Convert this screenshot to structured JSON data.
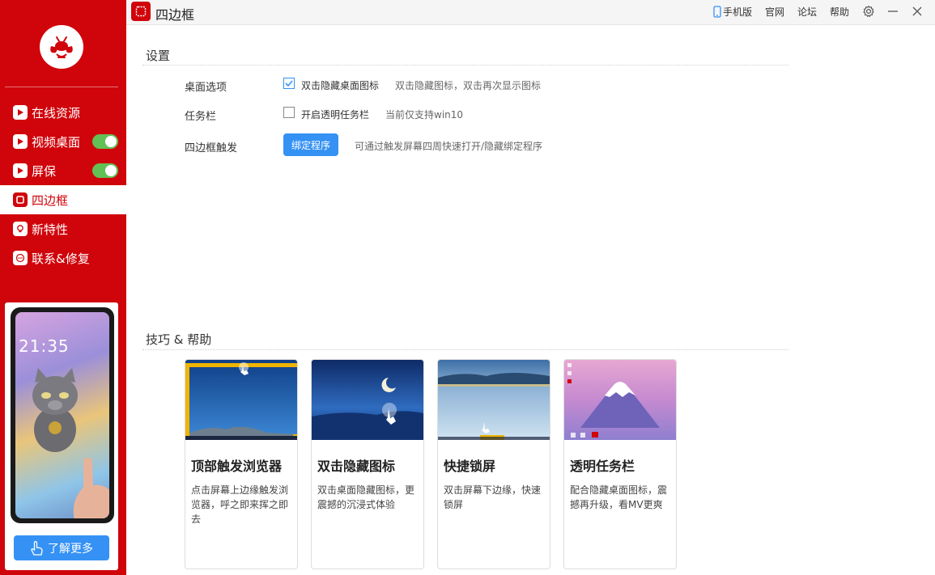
{
  "window": {
    "title": "四边框",
    "links": {
      "mobile": "手机版",
      "official": "官网",
      "forum": "论坛",
      "help": "帮助"
    }
  },
  "sidebar": {
    "items": [
      {
        "label": "在线资源",
        "icon": "play-icon",
        "toggle": null
      },
      {
        "label": "视频桌面",
        "icon": "play-icon",
        "toggle": true
      },
      {
        "label": "屏保",
        "icon": "play-icon",
        "toggle": true
      },
      {
        "label": "四边框",
        "icon": "frame-icon",
        "toggle": null,
        "active": true
      },
      {
        "label": "新特性",
        "icon": "bulb-icon",
        "toggle": null
      },
      {
        "label": "联系&修复",
        "icon": "chat-icon",
        "toggle": null
      }
    ],
    "promo": {
      "phone_time": "21:35",
      "button_label": "了解更多"
    }
  },
  "settings": {
    "title": "设置",
    "desktop": {
      "label": "桌面选项",
      "option": "双击隐藏桌面图标",
      "checked": true,
      "hint": "双击隐藏图标，双击再次显示图标"
    },
    "taskbar": {
      "label": "任务栏",
      "option": "开启透明任务栏",
      "checked": false,
      "hint": "当前仅支持win10"
    },
    "trigger": {
      "label": "四边框触发",
      "button": "绑定程序",
      "hint": "可通过触发屏幕四周快速打开/隐藏绑定程序"
    }
  },
  "help": {
    "title": "技巧 & 帮助",
    "cards": [
      {
        "title": "顶部触发浏览器",
        "desc": "点击屏幕上边缘触发浏览器，呼之即来挥之即去"
      },
      {
        "title": "双击隐藏图标",
        "desc": "双击桌面隐藏图标，更震撼的沉浸式体验"
      },
      {
        "title": "快捷锁屏",
        "desc": "双击屏幕下边缘，快速锁屏"
      },
      {
        "title": "透明任务栏",
        "desc": "配合隐藏桌面图标，震撼再升级，看MV更爽"
      }
    ]
  },
  "colors": {
    "brand_red": "#d0040b",
    "accent_blue": "#3592f4",
    "toggle_green": "#62c155",
    "edge_highlight": "#f0b400"
  }
}
